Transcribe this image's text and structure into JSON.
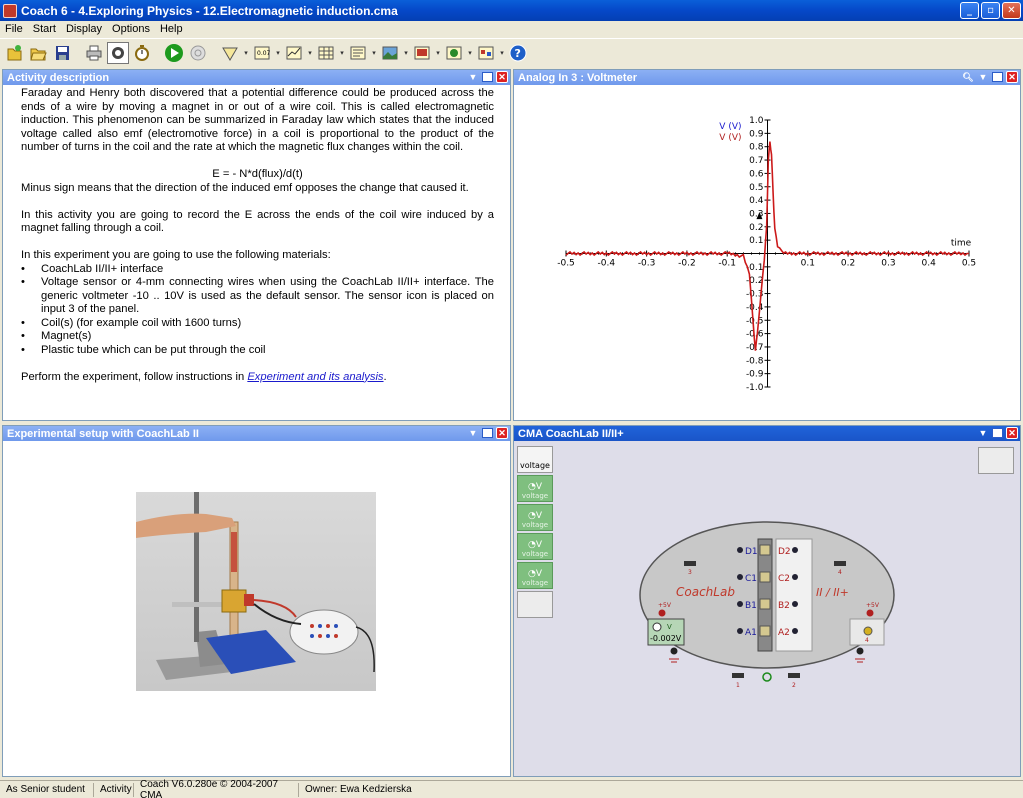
{
  "window": {
    "title": "Coach 6 - 4.Exploring Physics - 12.Electromagnetic induction.cma",
    "buttons": {
      "minimize": "_",
      "maximize": "▫",
      "close": "✕"
    }
  },
  "menu": [
    "File",
    "Start",
    "Display",
    "Options",
    "Help"
  ],
  "toolbar": {
    "icons": [
      "new-icon",
      "open-icon",
      "save-icon",
      "print-icon",
      "sensor-icon",
      "timer-icon",
      "start-icon",
      "stop-icon",
      "meter-icon",
      "value-icon",
      "graph-icon",
      "table-icon",
      "text-icon",
      "image-icon",
      "video-icon",
      "simulation-icon",
      "diagram-icon",
      "help-icon"
    ]
  },
  "activity_panel": {
    "title": "Activity description",
    "para1": "Faraday and Henry both discovered that a potential difference could be produced across the ends of a wire by moving a magnet in or out of a wire coil. This is called electromagnetic induction. This phenomenon can be summarized in Faraday law which states that the induced voltage called also emf (electromotive force) in a coil is proportional to the product of the number of turns in the coil and the rate at which the magnetic flux changes within the coil.",
    "formula": "E = - N*d(flux)/d(t)",
    "para2": "Minus sign means that the direction of the induced emf opposes the change that caused it.",
    "para3": "In this activity you are going to record the E across the ends of the coil wire induced by a magnet falling through a coil.",
    "para4": "In this experiment you are going to use the following materials:",
    "materials": [
      "CoachLab II/II+ interface",
      "Voltage sensor or 4-mm connecting wires when using the CoachLab II/II+ interface. The generic voltmeter -10 .. 10V is used as the default sensor. The sensor icon is placed on input 3 of the panel.",
      "Coil(s) (for example coil with 1600 turns)",
      "Magnet(s)",
      "Plastic tube which can be put through the coil"
    ],
    "para5_prefix": "Perform the experiment, follow instructions in ",
    "para5_link": "Experiment and its analysis",
    "para5_suffix": "."
  },
  "graph_panel": {
    "title": "Analog In 3 : Voltmeter"
  },
  "chart_data": {
    "type": "line",
    "title": "",
    "xlabel": "time",
    "ylabel": "V (V)",
    "legend": [
      "V (V)",
      "V (V)"
    ],
    "xlim": [
      -0.5,
      0.5
    ],
    "ylim": [
      -1.0,
      1.0
    ],
    "x_ticks": [
      "-0.5",
      "-0.4",
      "-0.3",
      "-0.2",
      "-0.1",
      "0.1",
      "0.2",
      "0.3",
      "0.4",
      "0.5"
    ],
    "y_ticks": [
      "1.0",
      "0.9",
      "0.8",
      "0.7",
      "0.6",
      "0.5",
      "0.4",
      "0.3",
      "0.2",
      "0.1",
      "-0.1",
      "-0.2",
      "-0.3",
      "-0.4",
      "-0.5",
      "-0.6",
      "-0.7",
      "-0.8",
      "-0.9",
      "-1.0"
    ],
    "grid": false,
    "series": [
      {
        "color": "#cc1a1a",
        "x": [
          -0.5,
          -0.1,
          -0.06,
          -0.045,
          -0.035,
          -0.03,
          -0.025,
          -0.015,
          -0.008,
          -0.002,
          0.002,
          0.006,
          0.01,
          0.014,
          0.018,
          0.025,
          0.035,
          0.05,
          0.5
        ],
        "y": [
          0.0,
          0.0,
          -0.02,
          -0.15,
          -0.55,
          -0.72,
          -0.6,
          -0.25,
          -0.05,
          0.2,
          0.7,
          0.83,
          0.75,
          0.45,
          0.2,
          0.05,
          0.01,
          0.0,
          0.0
        ]
      }
    ],
    "marker": {
      "x": -0.02,
      "y": 0.28
    }
  },
  "setup_panel": {
    "title": "Experimental setup with CoachLab II"
  },
  "coachlab_panel": {
    "title": "CMA CoachLab II/II+",
    "sensor_head": "voltage",
    "sensor_slot_label": "voltage",
    "sensor_slot_unit": "V",
    "brand": "CoachLab",
    "model": "II / II+",
    "reading": "-0.002V",
    "reading_unit": "V",
    "supply_label": "+5V",
    "digital": [
      "D1",
      "C1",
      "B1",
      "A1"
    ],
    "analog": [
      "D2",
      "C2",
      "B2",
      "A2"
    ],
    "inputs": [
      "1",
      "2",
      "3",
      "4"
    ]
  },
  "status": [
    "As Senior student",
    "Activity",
    "Coach V6.0.280e © 2004-2007 CMA",
    "Owner: Ewa Kedzierska"
  ]
}
